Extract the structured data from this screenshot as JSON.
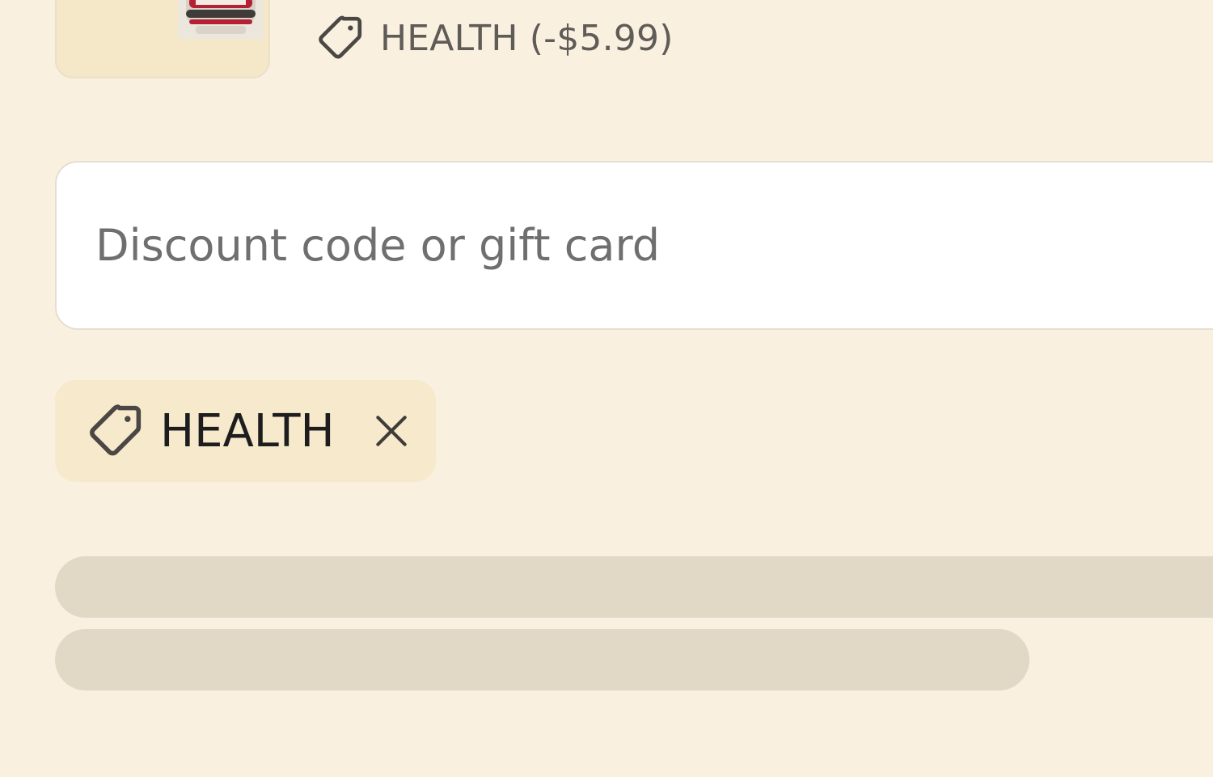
{
  "order_summary": {
    "line_item": {
      "thumbnail_alt": "Product thumbnail",
      "discount_line": "HEALTH (-$5.99)",
      "tag_icon": "tag-icon"
    },
    "discount_field": {
      "placeholder": "Discount code or gift card",
      "value": ""
    },
    "applied_code": {
      "label": "HEALTH",
      "tag_icon": "tag-icon",
      "remove_icon": "close-icon",
      "remove_label": "Remove discount HEALTH"
    },
    "loading_placeholders": 2
  },
  "colors": {
    "page_background": "#f9f0df",
    "chip_background": "#f6e9cc",
    "skeleton": "#e1d9c6",
    "muted_text": "#5f5b57"
  }
}
